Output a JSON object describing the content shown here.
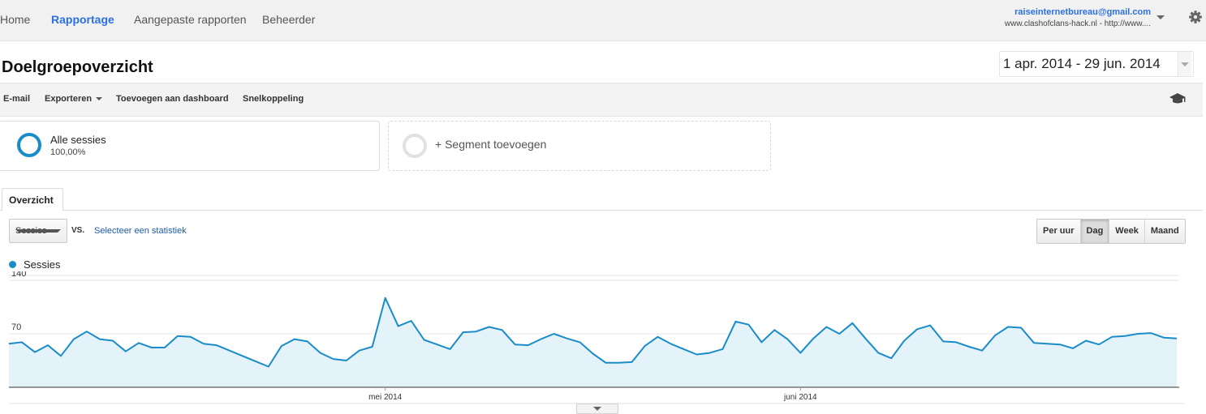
{
  "nav": {
    "items": [
      {
        "label": "Home",
        "active": false
      },
      {
        "label": "Rapportage",
        "active": true
      },
      {
        "label": "Aangepaste rapporten",
        "active": false
      },
      {
        "label": "Beheerder",
        "active": false
      }
    ]
  },
  "account": {
    "email": "raiseinternetbureau@gmail.com",
    "site": "www.clashofclans-hack.nl - http://www...."
  },
  "page": {
    "title": "Doelgroepoverzicht",
    "date_range": "1 apr. 2014 - 29 jun. 2014"
  },
  "toolbar": {
    "email": "E-mail",
    "export": "Exporteren",
    "add_dashboard": "Toevoegen aan dashboard",
    "shortcut": "Snelkoppeling"
  },
  "segments": {
    "active": {
      "label": "Alle sessies",
      "percent": "100,00%"
    },
    "add_label": "+ Segment toevoegen"
  },
  "tabs": {
    "overview": "Overzicht"
  },
  "controls": {
    "metric": "Sessies",
    "vs": "VS.",
    "select_stat": "Selecteer een statistiek",
    "time_buttons": [
      {
        "label": "Per uur",
        "active": false
      },
      {
        "label": "Dag",
        "active": true
      },
      {
        "label": "Week",
        "active": false
      },
      {
        "label": "Maand",
        "active": false
      }
    ]
  },
  "colors": {
    "series": "#1a8cc9",
    "fill": "#e4f2fa",
    "accent": "#2c6fe6"
  },
  "icons": {
    "gear": "gear-icon",
    "academy": "graduation-cap-icon",
    "segment": "donut-icon"
  },
  "chart_data": {
    "type": "area",
    "series": [
      {
        "name": "Sessies",
        "values": [
          57,
          59,
          46,
          55,
          41,
          63,
          73,
          63,
          61,
          47,
          58,
          52,
          52,
          67,
          66,
          57,
          55,
          48,
          41,
          34,
          27,
          54,
          63,
          60,
          45,
          37,
          35,
          48,
          53,
          117,
          80,
          87,
          62,
          56,
          50,
          72,
          73,
          79,
          75,
          56,
          55,
          63,
          70,
          64,
          59,
          44,
          32,
          32,
          33,
          54,
          66,
          57,
          50,
          43,
          45,
          50,
          86,
          82,
          59,
          75,
          63,
          45,
          64,
          79,
          70,
          84,
          64,
          45,
          38,
          61,
          76,
          81,
          60,
          59,
          53,
          48,
          68,
          79,
          78,
          58,
          57,
          56,
          51,
          61,
          56,
          66,
          67,
          70,
          71,
          65,
          64
        ]
      }
    ],
    "yticks": [
      70,
      140
    ],
    "ylim": [
      0,
      140
    ],
    "x_labels": [
      {
        "label": "mei 2014",
        "index": 29
      },
      {
        "label": "juni 2014",
        "index": 61
      }
    ],
    "grid": true
  }
}
